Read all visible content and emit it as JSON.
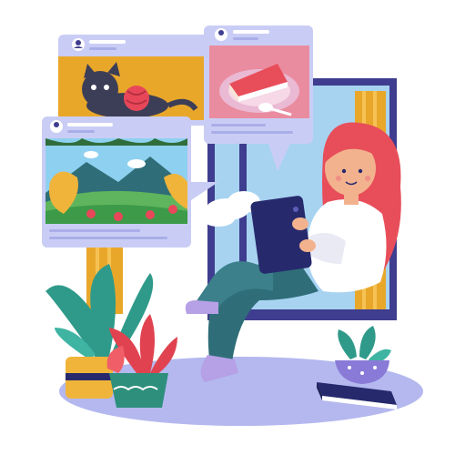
{
  "illustration": {
    "palette": {
      "card_bg": "#c9cdf5",
      "card_line": "#a9aee8",
      "floor": "#b4b8ef",
      "window_frame": "#3f3d8f",
      "window_glass": "#a7d3f1",
      "curtain": "#e9a72a",
      "hair": "#e84e5a",
      "skin": "#f3b28e",
      "sweater": "#ffffff",
      "pants": "#2f6e78",
      "socks": "#b6a0e6",
      "tablet": "#262a6d",
      "cat": "#3c3e57",
      "yarn": "#e8475a",
      "cake_plate": "#eab9d3",
      "plant_leaf": "#2f9a8a",
      "red_plant": "#e0434f",
      "pot_yellow": "#f0b43a",
      "pot_teal": "#2e8f7c",
      "book": "#262a6d",
      "pot_purple": "#8a7ad8"
    },
    "cards": [
      {
        "icon": "user-avatar-icon",
        "topic": "cat-with-yarn"
      },
      {
        "icon": "user-avatar-icon",
        "topic": "cake-slice"
      },
      {
        "icon": "user-avatar-icon",
        "topic": "mountain-landscape"
      }
    ]
  }
}
